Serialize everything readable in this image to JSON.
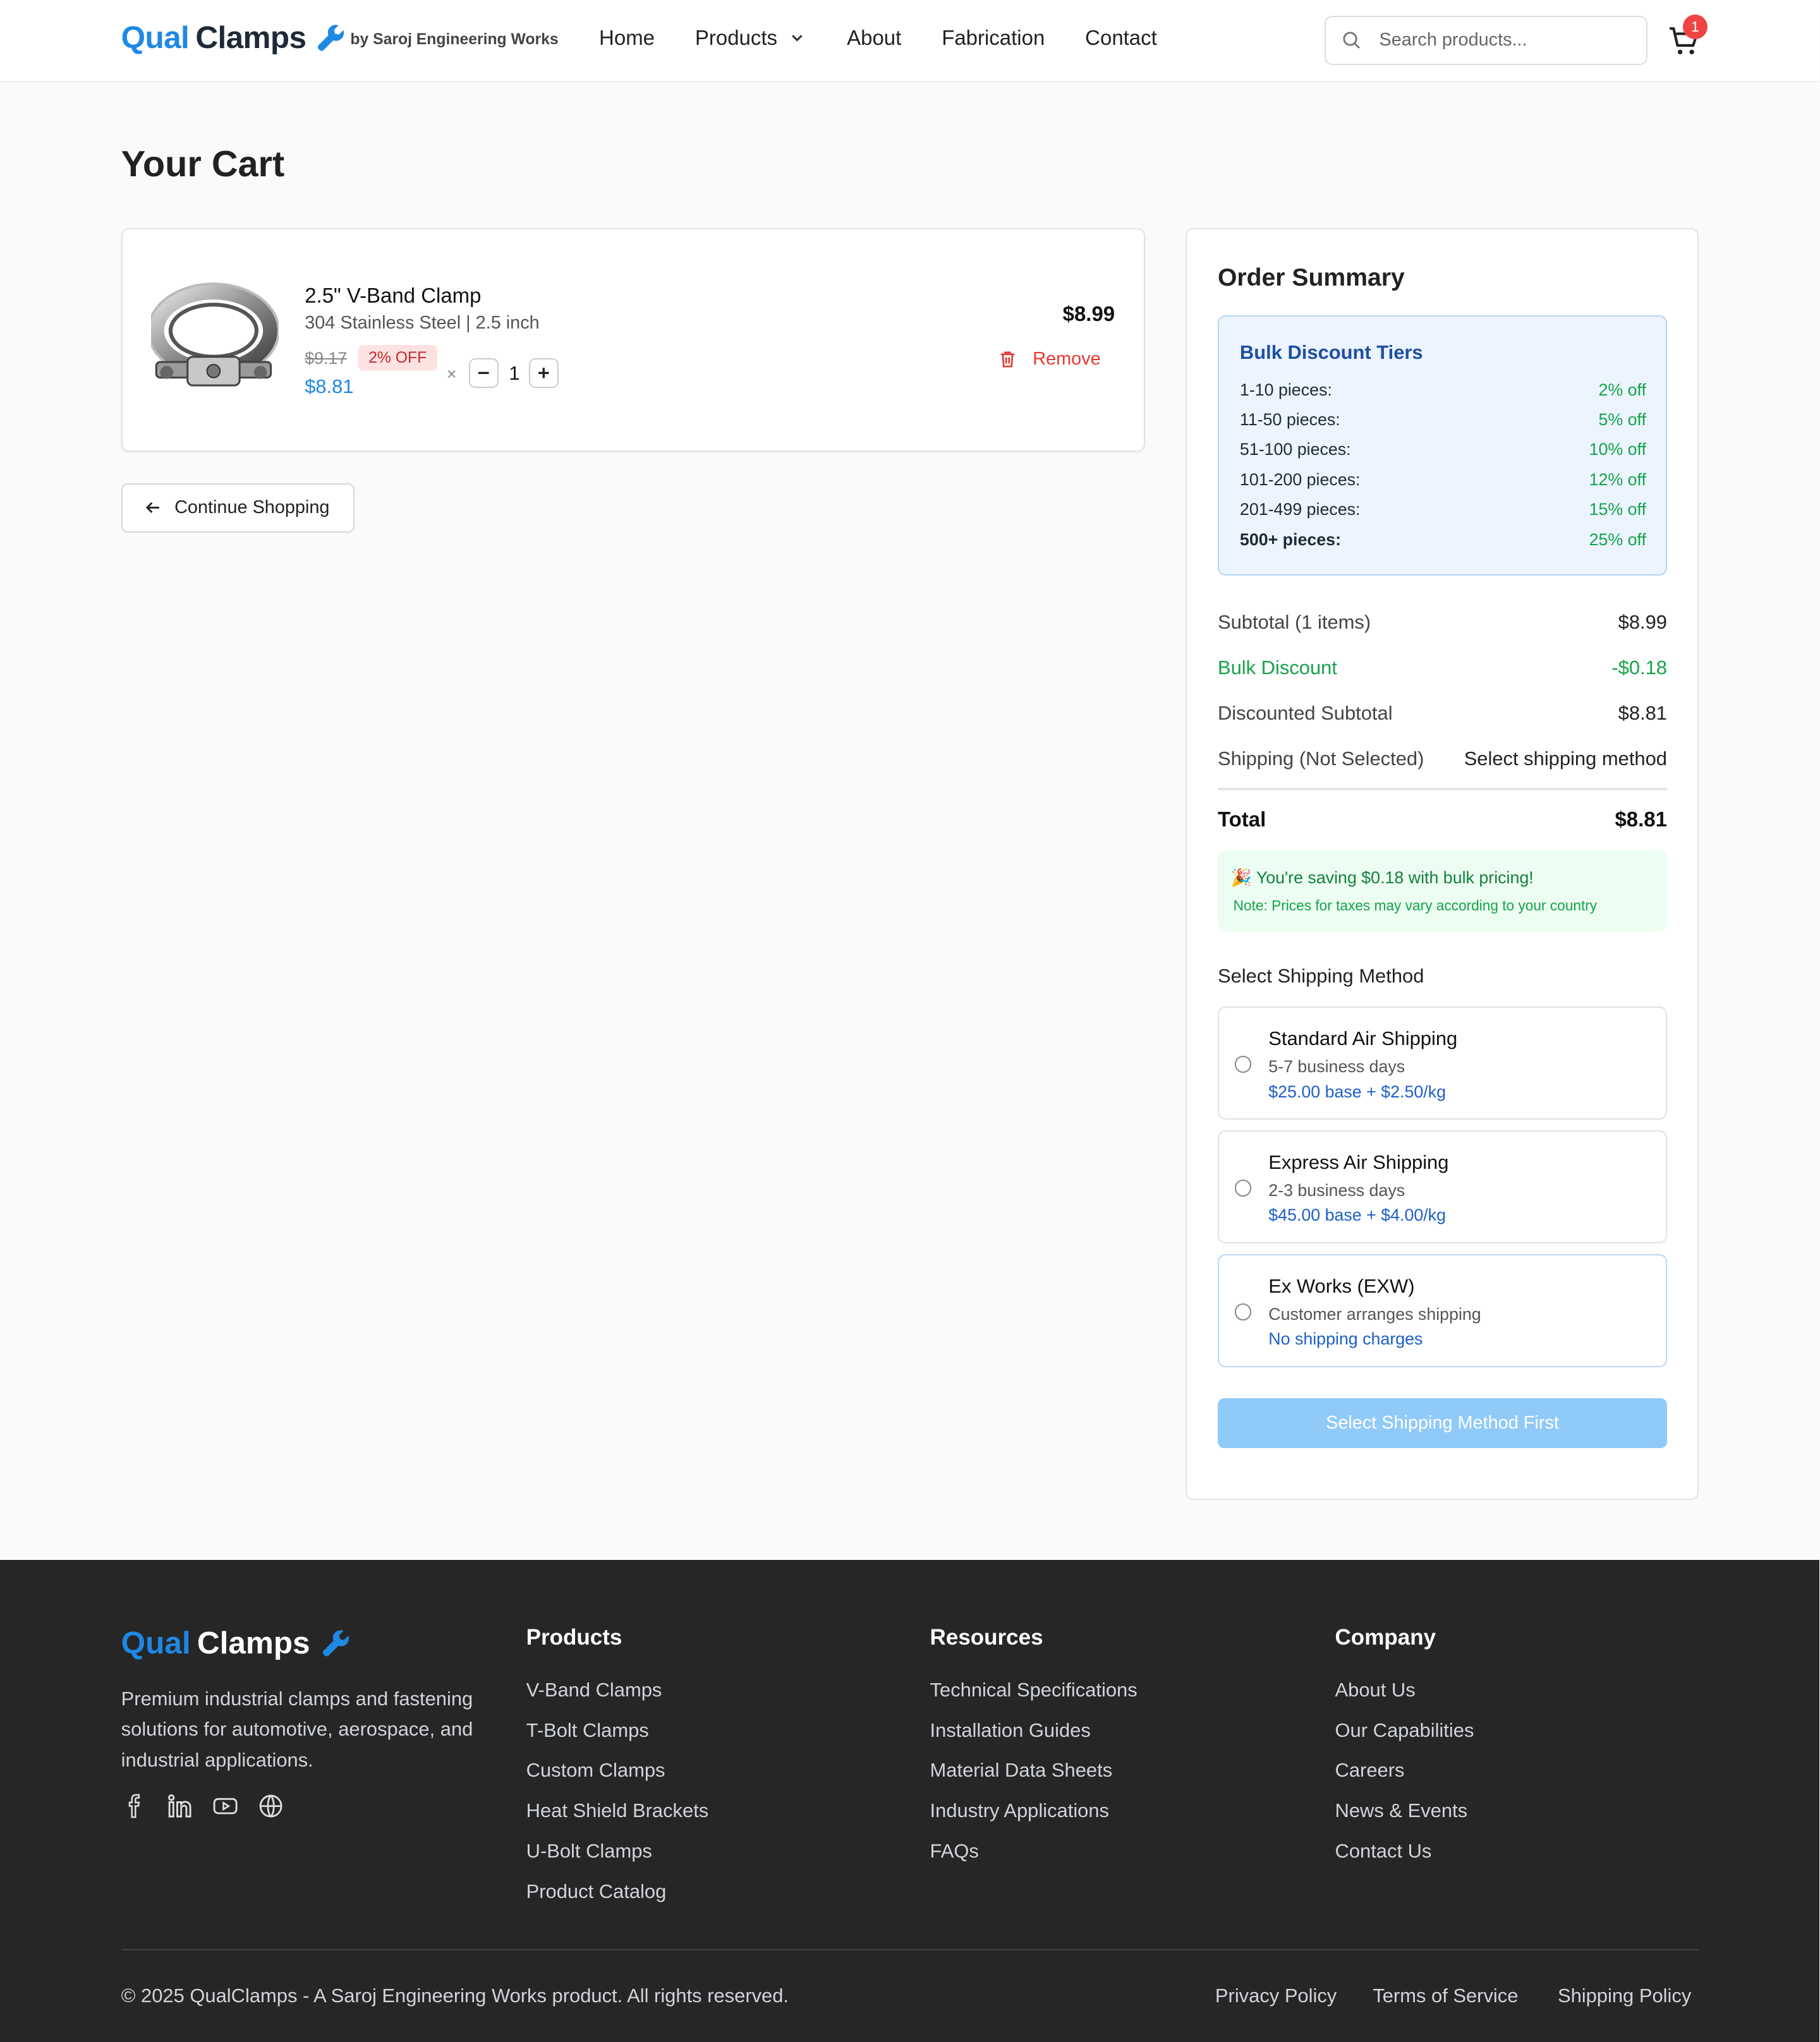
{
  "header": {
    "logo_part1": "Qual",
    "logo_part2": "Clamps",
    "byline": "by Saroj Engineering Works",
    "nav": {
      "home": "Home",
      "products": "Products",
      "about": "About",
      "fabrication": "Fabrication",
      "contact": "Contact"
    },
    "search_placeholder": "Search products...",
    "cart_count": "1"
  },
  "page_title": "Your Cart",
  "cart_item": {
    "name": "2.5\" V-Band Clamp",
    "spec": "304 Stainless Steel | 2.5 inch",
    "original_price": "$9.17",
    "discount_badge": "2% OFF",
    "unit_price": "$8.81",
    "multiply": "×",
    "quantity": "1",
    "line_total": "$8.99",
    "remove_label": "Remove",
    "image_icon": "v-band-clamp-image"
  },
  "continue_label": "Continue Shopping",
  "summary": {
    "title": "Order Summary",
    "tiers_title": "Bulk Discount Tiers",
    "tiers": [
      {
        "range": "1-10 pieces:",
        "off": "2% off"
      },
      {
        "range": "11-50 pieces:",
        "off": "5% off"
      },
      {
        "range": "51-100 pieces:",
        "off": "10% off"
      },
      {
        "range": "101-200 pieces:",
        "off": "12% off"
      },
      {
        "range": "201-499 pieces:",
        "off": "15% off"
      },
      {
        "range": "500+ pieces:",
        "off": "25% off"
      }
    ],
    "subtotal_label": "Subtotal (1 items)",
    "subtotal_value": "$8.99",
    "bulk_label": "Bulk Discount",
    "bulk_value": "-$0.18",
    "discounted_label": "Discounted Subtotal",
    "discounted_value": "$8.81",
    "shipping_label": "Shipping (Not Selected)",
    "shipping_value": "Select shipping method",
    "total_label": "Total",
    "total_value": "$8.81",
    "saving_text": "🎉 You're saving $0.18 with bulk pricing!",
    "saving_note": "Note: Prices for taxes may vary according to your country",
    "shipping_title": "Select Shipping Method",
    "shipping_options": [
      {
        "name": "Standard Air Shipping",
        "days": "5-7 business days",
        "price": "$25.00 base + $2.50/kg"
      },
      {
        "name": "Express Air Shipping",
        "days": "2-3 business days",
        "price": "$45.00 base + $4.00/kg"
      },
      {
        "name": "Ex Works (EXW)",
        "days": "Customer arranges shipping",
        "price": "No shipping charges"
      }
    ],
    "checkout_label": "Select Shipping Method First"
  },
  "footer": {
    "logo_part1": "Qual",
    "logo_part2": "Clamps",
    "description": "Premium industrial clamps and fastening solutions for automotive, aerospace, and industrial applications.",
    "social_icons": [
      "facebook-icon",
      "linkedin-icon",
      "youtube-icon",
      "globe-icon"
    ],
    "products_title": "Products",
    "products_links": [
      "V-Band Clamps",
      "T-Bolt Clamps",
      "Custom Clamps",
      "Heat Shield Brackets",
      "U-Bolt Clamps",
      "Product Catalog"
    ],
    "resources_title": "Resources",
    "resources_links": [
      "Technical Specifications",
      "Installation Guides",
      "Material Data Sheets",
      "Industry Applications",
      "FAQs"
    ],
    "company_title": "Company",
    "company_links": [
      "About Us",
      "Our Capabilities",
      "Careers",
      "News & Events",
      "Contact Us"
    ],
    "copyright": "© 2025 QualClamps - A Saroj Engineering Works product. All rights reserved.",
    "legal": {
      "privacy": "Privacy Policy",
      "terms": "Terms of Service",
      "shipping": "Shipping Policy"
    }
  },
  "colors": {
    "accent": "#1e88e5",
    "discount_green": "#16a34a",
    "danger": "#e53935",
    "footer_bg": "#262626"
  }
}
